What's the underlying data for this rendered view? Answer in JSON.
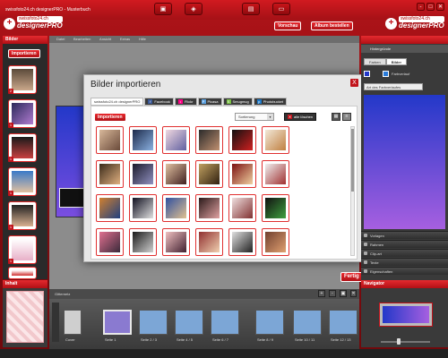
{
  "window": {
    "title": "swissfoto24.ch designerPRO - Musterbuch",
    "controls": [
      "-",
      "□",
      "✕"
    ]
  },
  "logo": {
    "site": "swissfoto24.ch",
    "product": "designerPRO"
  },
  "toolbar": {
    "tools": [
      "camera-icon",
      "palette-icon",
      "photos-icon",
      "monitor-icon"
    ],
    "preview_label": "Vorschau",
    "order_label": "Album bestellen"
  },
  "menu": [
    "Datei",
    "Bearbeiten",
    "Ansicht",
    "Extras",
    "Hilfe"
  ],
  "left_panel": {
    "title": "Bilder",
    "import_button": "Importieren",
    "thumb_badges": [
      "2",
      "1",
      "1",
      "1",
      "1",
      "1"
    ],
    "bottom_title": "Inhalt"
  },
  "dialog": {
    "title": "Bilder importieren",
    "close": "X",
    "tabs": [
      {
        "label": "swissfoto24.ch designerPRO",
        "icon": ""
      },
      {
        "label": "Facebook",
        "icon": "f"
      },
      {
        "label": "Flickr",
        "icon": "•"
      },
      {
        "label": "Picasa",
        "icon": "P"
      },
      {
        "label": "Smugmug",
        "icon": "S"
      },
      {
        "label": "Photobucket",
        "icon": "p"
      }
    ],
    "import_button": "Importieren",
    "sort_label": "Sortierung",
    "delete_all": "alle löschen",
    "done_button": "Fertig"
  },
  "right_panel": {
    "title": "Hintergründe",
    "tabs": [
      "Farben",
      "Bilder"
    ],
    "color_label": "Farbverlauf",
    "gradient_type": "Art des Farbverlaufes",
    "accordions": [
      "Vorlagen",
      "Rahmen",
      "Clip-art",
      "Texte",
      "Eigenschaften"
    ],
    "navigator_title": "Navigator"
  },
  "filmstrip": {
    "grid_label": "Gitternetz",
    "pages": [
      "Cover",
      "Seite 1",
      "Seite 2 / 3",
      "Seite 4 / 5",
      "Seite 6 / 7",
      "Seite 8 / 9",
      "Seite 10 / 11",
      "Seite 12 / 13"
    ]
  },
  "colors": {
    "brand_red": "#c1121a",
    "dark": "#2a2a2a",
    "gradient_top": "#2338c9",
    "gradient_bottom": "#a65fe0"
  }
}
